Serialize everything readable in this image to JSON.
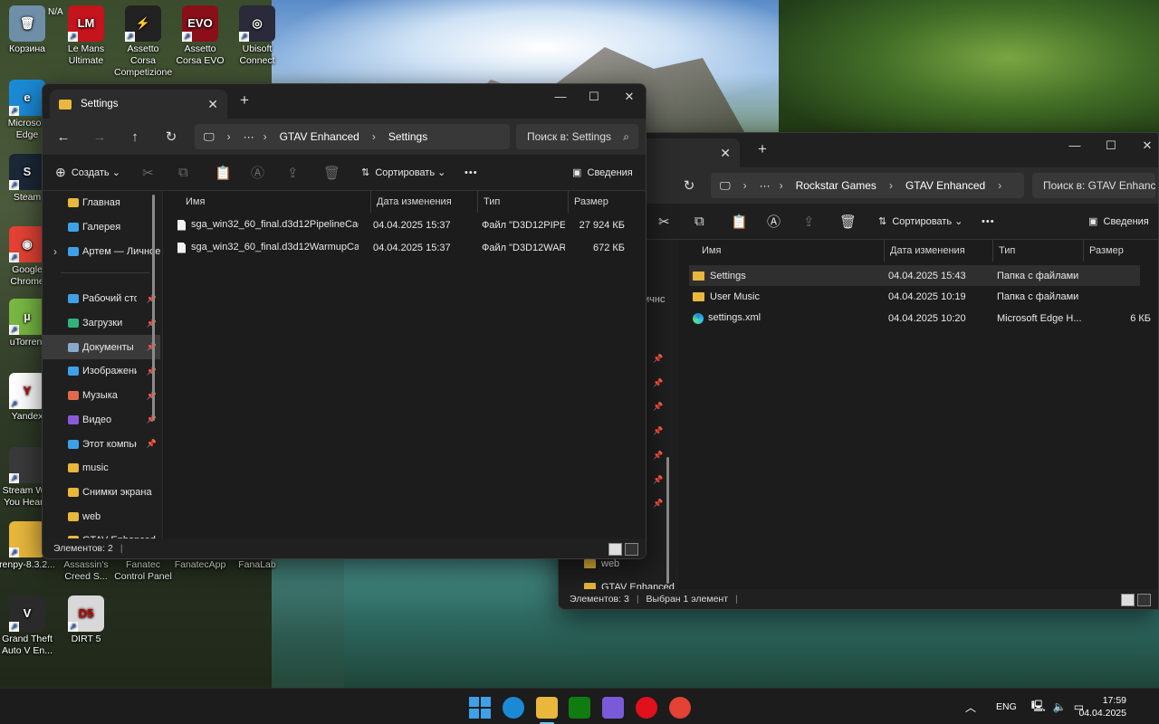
{
  "desktop": {
    "top_status": "кадров/с  N/A",
    "icons": [
      {
        "label": "Корзина",
        "color": "#6f8fa8",
        "glyph": "🗑"
      },
      {
        "label": "Le Mans Ultimate",
        "color": "#c4141c",
        "glyph": "LM"
      },
      {
        "label": "Assetto Corsa Competizione",
        "color": "#222222",
        "glyph": "⚡"
      },
      {
        "label": "Assetto Corsa EVO",
        "color": "#8a0f18",
        "glyph": "EVO"
      },
      {
        "label": "Ubisoft Connect",
        "color": "#2a2a3a",
        "glyph": "◎"
      },
      {
        "label": "Microsoft Edge",
        "color": "#1b8ad6",
        "glyph": "e"
      },
      {
        "label": "Steam",
        "color": "#1b2838",
        "glyph": "S"
      },
      {
        "label": "Google Chrome",
        "color": "#e44235",
        "glyph": "◉"
      },
      {
        "label": "uTorrent",
        "color": "#78b843",
        "glyph": "µ"
      },
      {
        "label": "Yandex",
        "color": "#ffffff",
        "glyph": "Y"
      },
      {
        "label": "Stream W... You Hear...",
        "color": "#3a3a3a",
        "glyph": ""
      },
      {
        "label": "renpy-8.3.2...",
        "color": "#e8b73c",
        "glyph": ""
      },
      {
        "label": "Assassin's Creed S...",
        "color": "#444444",
        "glyph": ""
      },
      {
        "label": "Fanatec Control Panel",
        "color": "#444444",
        "glyph": ""
      },
      {
        "label": "FanatecApp",
        "color": "#444444",
        "glyph": ""
      },
      {
        "label": "FanaLab",
        "color": "#444444",
        "glyph": ""
      },
      {
        "label": "Grand Theft Auto V En...",
        "color": "#2a2a2a",
        "glyph": "V"
      },
      {
        "label": "DIRT 5",
        "color": "#d8d8d8",
        "glyph": "D5"
      }
    ]
  },
  "window_front": {
    "tab_title": "Settings",
    "new_tab": "+",
    "breadcrumb": [
      "GTAV Enhanced",
      "Settings"
    ],
    "search_placeholder": "Поиск в: Settings",
    "toolbar": {
      "create": "Создать",
      "sort": "Сортировать",
      "details": "Сведения",
      "more": "•••"
    },
    "sidebar": [
      {
        "label": "Главная",
        "color": "#e8b73c",
        "pin": false
      },
      {
        "label": "Галерея",
        "color": "#3ea1e8",
        "pin": false
      },
      {
        "label": "Артем — Личное",
        "color": "#3ea1e8",
        "pin": false
      },
      {
        "label": "Рабочий стол",
        "color": "#3ea1e8",
        "pin": true
      },
      {
        "label": "Загрузки",
        "color": "#2fb37a",
        "pin": true
      },
      {
        "label": "Документы",
        "color": "#8aa8c8",
        "pin": true
      },
      {
        "label": "Изображения",
        "color": "#3ea1e8",
        "pin": true
      },
      {
        "label": "Музыка",
        "color": "#e0684c",
        "pin": true
      },
      {
        "label": "Видео",
        "color": "#8a5ad8",
        "pin": true
      },
      {
        "label": "Этот компьютер",
        "color": "#3ea1e8",
        "pin": true
      },
      {
        "label": "music",
        "color": "#e8b73c",
        "pin": false
      },
      {
        "label": "Снимки экрана",
        "color": "#e8b73c",
        "pin": false
      },
      {
        "label": "web",
        "color": "#e8b73c",
        "pin": false
      },
      {
        "label": "GTAV Enhanced",
        "color": "#e8b73c",
        "pin": false
      }
    ],
    "columns": [
      "Имя",
      "Дата изменения",
      "Тип",
      "Размер"
    ],
    "rows": [
      {
        "name": "sga_win32_60_final.d3d12PipelineCache...",
        "date": "04.04.2025 15:37",
        "type": "Файл \"D3D12PIPE...",
        "size": "27 924 КБ"
      },
      {
        "name": "sga_win32_60_final.d3d12WarmupCache...",
        "date": "04.04.2025 15:37",
        "type": "Файл \"D3D12WAR...",
        "size": "672 КБ"
      }
    ],
    "status": "Элементов: 2"
  },
  "window_back": {
    "breadcrumb": [
      "Rockstar Games",
      "GTAV Enhanced"
    ],
    "search_placeholder": "Поиск в: GTAV Enhanced",
    "toolbar": {
      "sort": "Сортировать",
      "details": "Сведения",
      "more": "•••"
    },
    "columns": [
      "Имя",
      "Дата изменения",
      "Тип",
      "Размер"
    ],
    "rows": [
      {
        "name": "Settings",
        "date": "04.04.2025 15:43",
        "type": "Папка с файлами",
        "size": "",
        "kind": "folder"
      },
      {
        "name": "User Music",
        "date": "04.04.2025 10:19",
        "type": "Папка с файлами",
        "size": "",
        "kind": "folder"
      },
      {
        "name": "settings.xml",
        "date": "04.04.2025 10:20",
        "type": "Microsoft Edge H...",
        "size": "6 КБ",
        "kind": "edge"
      }
    ],
    "sidebar_partial": [
      "ичнс",
      "web",
      "GTAV Enhanced"
    ],
    "status": "Элементов: 3",
    "status_selected": "Выбран 1 элемент"
  },
  "taskbar": {
    "apps": [
      {
        "name": "start",
        "color": "#3ea1e8"
      },
      {
        "name": "edge",
        "color": "#1b8ad6"
      },
      {
        "name": "explorer",
        "color": "#e8b73c"
      },
      {
        "name": "xbox",
        "color": "#107c10"
      },
      {
        "name": "app",
        "color": "#7a5ad8"
      },
      {
        "name": "opera",
        "color": "#e0101c"
      },
      {
        "name": "chrome",
        "color": "#e44235"
      }
    ],
    "lang": "ENG",
    "time": "17:59",
    "date": "04.04.2025"
  }
}
